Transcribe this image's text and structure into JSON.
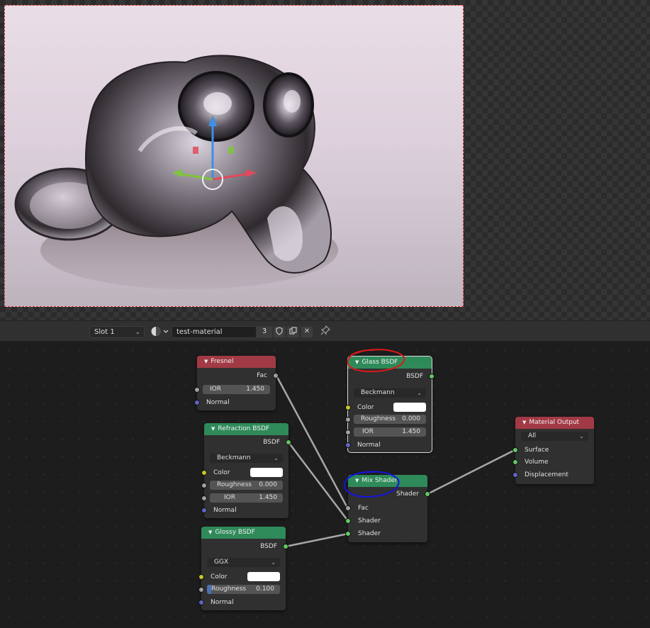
{
  "header": {
    "slot": "Slot 1",
    "material_name": "test-material",
    "user_count": "3"
  },
  "icons": {
    "material_type": "material-sphere-icon",
    "fake_user": "shield-icon",
    "duplicate": "duplicate-icon",
    "unlink": "close-icon",
    "pin": "pin-icon"
  },
  "nodes": {
    "fresnel": {
      "title": "Fresnel",
      "out_fac": "Fac",
      "ior_label": "IOR",
      "ior_value": "1.450",
      "normal": "Normal"
    },
    "refraction": {
      "title": "Refraction BSDF",
      "out": "BSDF",
      "distribution": "Beckmann",
      "color": "Color",
      "roughness_label": "Roughness",
      "roughness_value": "0.000",
      "ior_label": "IOR",
      "ior_value": "1.450",
      "normal": "Normal"
    },
    "glossy": {
      "title": "Glossy BSDF",
      "out": "BSDF",
      "distribution": "GGX",
      "color": "Color",
      "roughness_label": "Roughness",
      "roughness_value": "0.100",
      "normal": "Normal"
    },
    "glass": {
      "title": "Glass BSDF",
      "out": "BSDF",
      "distribution": "Beckmann",
      "color": "Color",
      "roughness_label": "Roughness",
      "roughness_value": "0.000",
      "ior_label": "IOR",
      "ior_value": "1.450",
      "normal": "Normal"
    },
    "mix": {
      "title": "Mix Shader",
      "out": "Shader",
      "fac": "Fac",
      "shader1": "Shader",
      "shader2": "Shader"
    },
    "output": {
      "title": "Material Output",
      "target": "All",
      "surface": "Surface",
      "volume": "Volume",
      "displacement": "Displacement"
    }
  },
  "colors": {
    "shader_header": "#2f8a5a",
    "input_header": "#a23a45",
    "annotation_red": "#e01818",
    "annotation_blue": "#1414e0"
  }
}
